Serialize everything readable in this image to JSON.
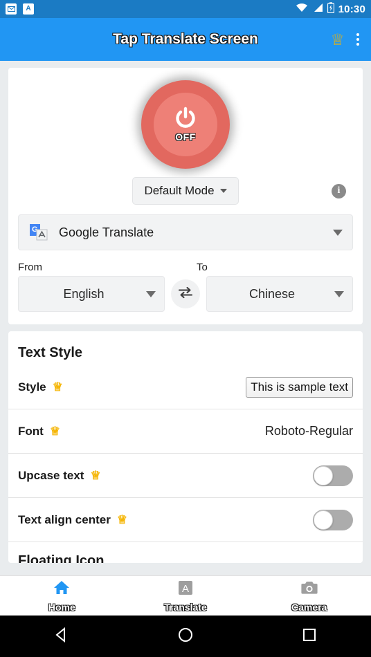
{
  "statusbar": {
    "icons": [
      "email-icon",
      "keyboard-a-icon"
    ],
    "wifi": "wifi-icon",
    "signal": "signal-icon",
    "battery": "battery-charging-icon",
    "time": "10:30"
  },
  "appbar": {
    "title": "Tap Translate Screen",
    "premium_icon": "crown-icon",
    "overflow_icon": "more-vertical-icon"
  },
  "power": {
    "label": "OFF",
    "icon": "power-icon",
    "outer_color": "#E2685F",
    "inner_color": "#EE8077"
  },
  "mode": {
    "label": "Default Mode",
    "caret_icon": "chevron-down-icon",
    "info_icon": "info-icon",
    "info_glyph": "i"
  },
  "service": {
    "name": "Google Translate",
    "icon": "google-translate-icon",
    "icon_letter": "G",
    "caret_icon": "chevron-down-icon"
  },
  "languages": {
    "from_label": "From",
    "to_label": "To",
    "from_value": "English",
    "to_value": "Chinese",
    "swap_icon": "swap-horizontal-icon"
  },
  "text_style": {
    "section_title": "Text Style",
    "rows": [
      {
        "label": "Style",
        "premium": true,
        "value": "This is sample text",
        "kind": "sample"
      },
      {
        "label": "Font",
        "premium": true,
        "value": "Roboto-Regular",
        "kind": "text"
      },
      {
        "label": "Upcase text",
        "premium": true,
        "value": "off",
        "kind": "toggle"
      },
      {
        "label": "Text align center",
        "premium": true,
        "value": "off",
        "kind": "toggle"
      }
    ],
    "next_section_title": "Floating Icon",
    "crown_icon": "crown-icon"
  },
  "bottomnav": {
    "items": [
      {
        "label": "Home",
        "icon": "home-icon",
        "active": true
      },
      {
        "label": "Translate",
        "icon": "translate-a-icon",
        "active": false
      },
      {
        "label": "Camera",
        "icon": "camera-icon",
        "active": false
      }
    ],
    "active_color": "#2196F3",
    "inactive_color": "#9E9E9E"
  },
  "android_nav": {
    "back": "back-triangle-icon",
    "home": "home-circle-icon",
    "recents": "recents-square-icon"
  },
  "colors": {
    "appbar": "#2196F3",
    "statusbar": "#1B7BC4",
    "page_bg": "#E9ECEE",
    "crown": "#F5B400"
  }
}
